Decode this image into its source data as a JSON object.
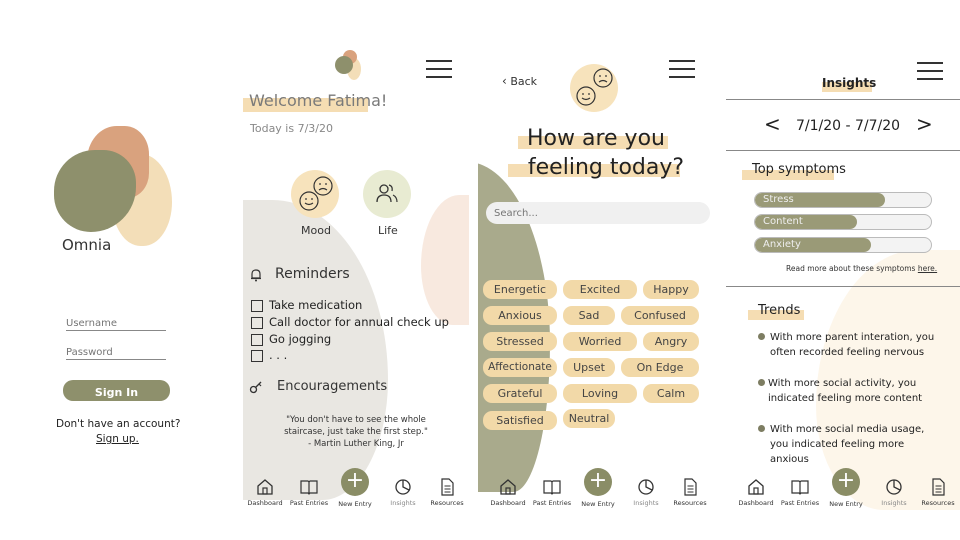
{
  "login": {
    "app_name": "Omnia",
    "username_placeholder": "Username",
    "password_placeholder": "Password",
    "sign_in": "Sign In",
    "no_account": "Don't have an account?",
    "sign_up": "Sign up."
  },
  "dashboard": {
    "welcome": "Welcome Fatima!",
    "today": "Today is 7/3/20",
    "mood": "Mood",
    "life": "Life",
    "reminders_title": "Reminders",
    "reminders": [
      "Take medication",
      "Call doctor for annual check up",
      "Go jogging",
      ". . ."
    ],
    "encouragements_title": "Encouragements",
    "quote_1": "\"You don't have to see the whole",
    "quote_2": "staircase, just take the first step.\"",
    "quote_3": "- Martin Luther King, Jr"
  },
  "mood": {
    "back": "Back",
    "heading_1": "How are you",
    "heading_2": "feeling today?",
    "search_placeholder": "Search...",
    "feelings": [
      "Energetic",
      "Excited",
      "Happy",
      "Anxious",
      "Sad",
      "Confused",
      "Stressed",
      "Worried",
      "Angry",
      "Affectionate",
      "Upset",
      "On Edge",
      "Grateful",
      "Loving",
      "Calm",
      "Satisfied",
      "Neutral"
    ]
  },
  "insights": {
    "title": "Insights",
    "date_range": "7/1/20 - 7/7/20",
    "top_symptoms": "Top symptoms",
    "symptoms": [
      {
        "label": "Stress",
        "level": 0.74
      },
      {
        "label": "Content",
        "level": 0.58
      },
      {
        "label": "Anxiety",
        "level": 0.66
      }
    ],
    "read_more": "Read more about these symptoms",
    "here": "here.",
    "trends_title": "Trends",
    "trend_1a": "With more parent interation, you",
    "trend_1b": "often recorded feeling nervous",
    "trend_2a": "With more social activity, you",
    "trend_2b": "indicated feeling more content",
    "trend_3a": "With more social media usage,",
    "trend_3b": "you indicated feeling more",
    "trend_3c": "anxious"
  },
  "nav": {
    "dashboard": "Dashboard",
    "past_entries": "Past Entries",
    "new_entry": "New Entry",
    "insights": "Insights",
    "resources": "Resources",
    "plus": "+"
  },
  "colors": {
    "sage": "#9a9a77",
    "peach": "#f5ddb3",
    "terracotta": "#d9a27e",
    "light_grey": "#e9e7e2"
  }
}
